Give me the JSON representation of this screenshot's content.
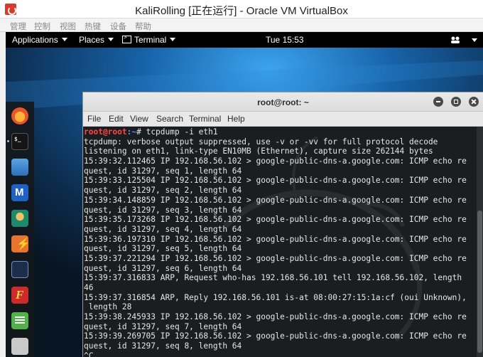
{
  "vbox": {
    "title": "KaliRolling [正在运行] - Oracle VM VirtualBox",
    "menu": [
      "管理",
      "控制",
      "视图",
      "热键",
      "设备",
      "帮助"
    ]
  },
  "topbar": {
    "applications": "Applications",
    "places": "Places",
    "terminal": "Terminal",
    "time": "Tue 15:53"
  },
  "dock": [
    "firefox-icon",
    "terminal-icon",
    "files-icon",
    "metasploit-icon",
    "armitage-icon",
    "burpsuite-icon",
    "maltego-icon",
    "faraday-icon",
    "leafpad-icon",
    "app-icon"
  ],
  "terminal": {
    "title": "root@root: ~",
    "menu": [
      "File",
      "Edit",
      "View",
      "Search",
      "Terminal",
      "Help"
    ],
    "prompt_user": "root@root",
    "prompt_path": ":~",
    "prompt_cmd": "# tcpdump -i eth1",
    "lines": [
      "tcpdump: verbose output suppressed, use -v or -vv for full protocol decode",
      "listening on eth1, link-type EN10MB (Ethernet), capture size 262144 bytes",
      "15:39:32.112465 IP 192.168.56.102 > google-public-dns-a.google.com: ICMP echo re",
      "quest, id 31297, seq 1, length 64",
      "15:39:33.125504 IP 192.168.56.102 > google-public-dns-a.google.com: ICMP echo re",
      "quest, id 31297, seq 2, length 64",
      "15:39:34.148859 IP 192.168.56.102 > google-public-dns-a.google.com: ICMP echo re",
      "quest, id 31297, seq 3, length 64",
      "15:39:35.173268 IP 192.168.56.102 > google-public-dns-a.google.com: ICMP echo re",
      "quest, id 31297, seq 4, length 64",
      "15:39:36.197310 IP 192.168.56.102 > google-public-dns-a.google.com: ICMP echo re",
      "quest, id 31297, seq 5, length 64",
      "15:39:37.221294 IP 192.168.56.102 > google-public-dns-a.google.com: ICMP echo re",
      "quest, id 31297, seq 6, length 64",
      "15:39:37.316833 ARP, Request who-has 192.168.56.101 tell 192.168.56.102, length",
      "46",
      "15:39:37.316854 ARP, Reply 192.168.56.101 is-at 08:00:27:15:1a:cf (oui Unknown),",
      " length 28",
      "15:39:38.245933 IP 192.168.56.102 > google-public-dns-a.google.com: ICMP echo re",
      "quest, id 31297, seq 7, length 64",
      "15:39:39.269705 IP 192.168.56.102 > google-public-dns-a.google.com: ICMP echo re",
      "quest, id 31297, seq 8, length 64",
      "^C"
    ]
  },
  "colors": {
    "terminal_bg": "#1b1e21",
    "prompt_user": "#ff4545",
    "prompt_path": "#5b8df7",
    "desktop_accent": "#1e7fd0"
  }
}
